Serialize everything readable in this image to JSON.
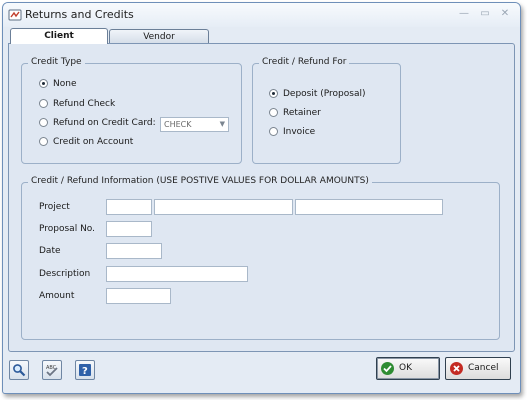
{
  "window": {
    "title": "Returns and Credits",
    "controls": {
      "minimize": "—",
      "maximize": "▭",
      "close": "✕"
    }
  },
  "tabs": [
    {
      "label": "Client",
      "active": true
    },
    {
      "label": "Vendor",
      "active": false
    }
  ],
  "credit_type": {
    "legend": "Credit Type",
    "options": [
      {
        "label": "None",
        "selected": true
      },
      {
        "label": "Refund Check",
        "selected": false
      },
      {
        "label": "Refund on Credit Card:",
        "selected": false
      },
      {
        "label": "Credit on Account",
        "selected": false
      }
    ],
    "card_select": {
      "value": "CHECK"
    }
  },
  "refund_for": {
    "legend": "Credit / Refund For",
    "options": [
      {
        "label": "Deposit (Proposal)",
        "selected": true
      },
      {
        "label": "Retainer",
        "selected": false
      },
      {
        "label": "Invoice",
        "selected": false
      }
    ]
  },
  "info": {
    "legend": "Credit / Refund Information (USE POSTIVE VALUES FOR DOLLAR AMOUNTS)",
    "project_label": "Project",
    "project_values": [
      "",
      "",
      ""
    ],
    "proposal_label": "Proposal No.",
    "proposal_value": "",
    "date_label": "Date",
    "date_value": "",
    "description_label": "Description",
    "description_value": "",
    "amount_label": "Amount",
    "amount_value": ""
  },
  "toolbar": {
    "icons": [
      "search-icon",
      "spell-check-icon",
      "help-icon"
    ]
  },
  "actions": {
    "ok_label": "OK",
    "cancel_label": "Cancel"
  },
  "colors": {
    "window_bg": "#e4ebf4",
    "panel_bg": "#dfe7f2",
    "border": "#7d95b4",
    "ok_green": "#2e8c32",
    "cancel_red": "#c42b23"
  }
}
